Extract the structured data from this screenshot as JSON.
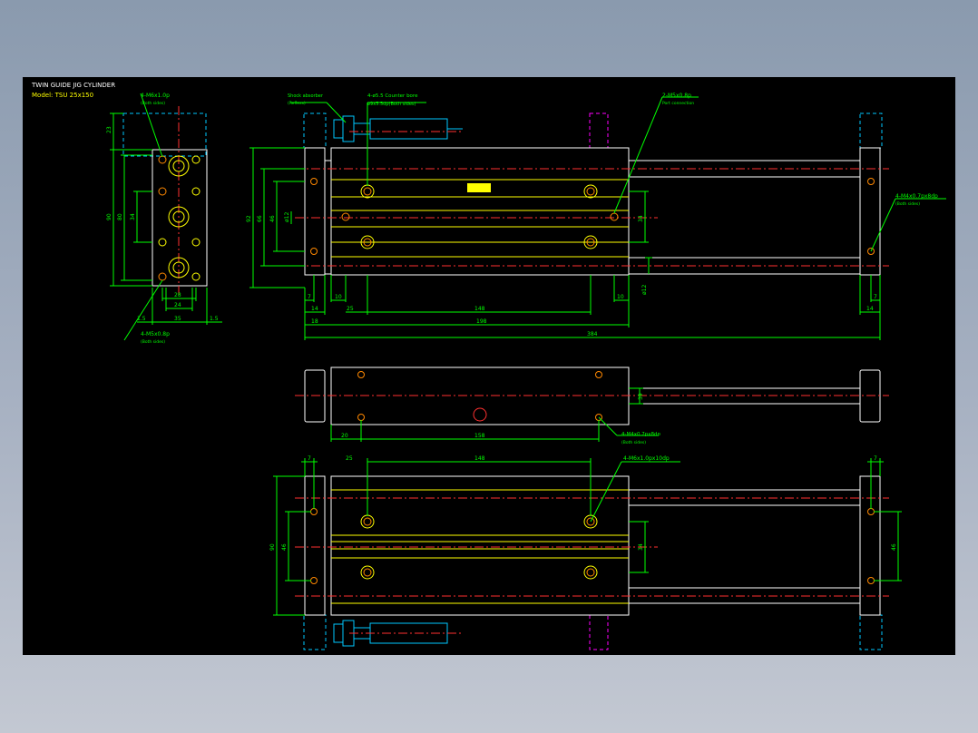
{
  "drawing": {
    "title": "TWIN GUIDE JIG CYLINDER",
    "model": "Model: TSU 25x150"
  },
  "colors": {
    "background": "#000000",
    "outline": "#ffffff",
    "yellow": "#ffff00",
    "dimension": "#00ff00",
    "centerline": "#ff3030",
    "hidden": "#00c8ff",
    "magenta": "#ff00ff",
    "hole": "#ff8800"
  },
  "icons": {
    "logo": "manufacturer-logo-icon"
  },
  "end_view": {
    "callout_top": "4-M6x1.0p",
    "callout_top_sub": "(Both sides)",
    "callout_bottom": "4-M5x0.8p",
    "callout_bottom_sub": "(Both sides)",
    "dims": {
      "d23": "23",
      "d90": "90",
      "d80": "80",
      "d34": "34",
      "d28": "28",
      "d24": "24",
      "d35": "35",
      "d15a": "1.5",
      "d15b": "1.5"
    }
  },
  "front_view": {
    "callout_bumper": "Shock absorber",
    "callout_bumper_sub": "(Reflexs)",
    "callout_cbore": "4-ø5.5 Counter bore",
    "callout_cbore_sub": "ø9x5.5dp(Both sides)",
    "callout_port": "2-M5x0.8p",
    "callout_port_sub": "Port connection",
    "callout_rod": "4-M4x0.7px8dp",
    "callout_rod_sub": "(Both sides)",
    "dims": {
      "d92": "92",
      "d66": "66",
      "d46": "46",
      "d12a": "ø12",
      "d34": "34",
      "d12b": "ø12",
      "d7a": "7",
      "d10a": "10",
      "d14a": "14",
      "d25": "25",
      "d148": "148",
      "d10b": "10",
      "d18": "18",
      "d198": "198",
      "d384": "384",
      "d7b": "7",
      "d14b": "14"
    }
  },
  "top_view": {
    "callout": "4-M4x0.7px8dp",
    "callout_sub": "(Both sides)",
    "dims": {
      "d39": "39",
      "d20": "20",
      "d158": "158"
    }
  },
  "bottom_view": {
    "callout": "4-M6x1.0px10dp",
    "dims": {
      "d7a": "7",
      "d25": "25",
      "d148": "148",
      "d7b": "7",
      "d90": "90",
      "d46a": "46",
      "d34": "34",
      "d46b": "46"
    }
  }
}
